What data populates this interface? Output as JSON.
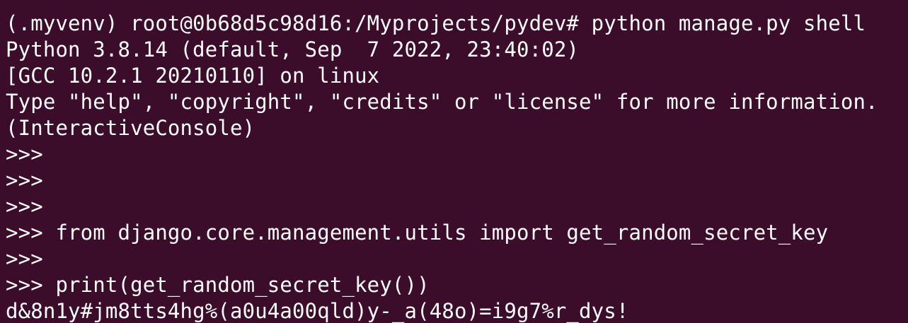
{
  "terminal": {
    "background": "#3c0c2b",
    "foreground": "#ffffff",
    "lines": [
      "(.myvenv) root@0b68d5c98d16:/Myprojects/pydev# python manage.py shell",
      "Python 3.8.14 (default, Sep  7 2022, 23:40:02)",
      "[GCC 10.2.1 20210110] on linux",
      "Type \"help\", \"copyright\", \"credits\" or \"license\" for more information.",
      "(InteractiveConsole)",
      ">>>",
      ">>>",
      ">>>",
      ">>> from django.core.management.utils import get_random_secret_key",
      ">>>",
      ">>> print(get_random_secret_key())",
      "d&8n1y#jm8tts4hg%(a0u4a00qld)y-_a(48o)=i9g7%r_dys!"
    ]
  }
}
